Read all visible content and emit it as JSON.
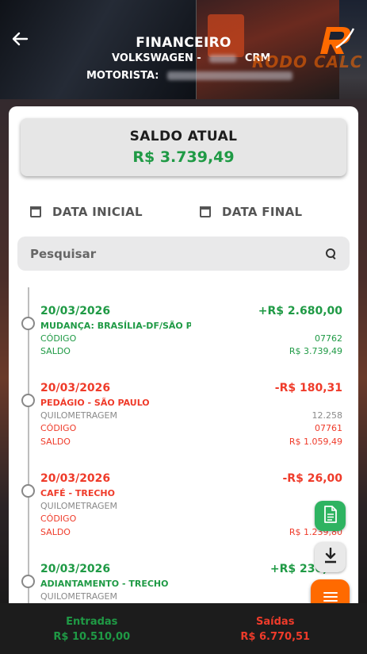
{
  "header": {
    "title": "FINANCEIRO",
    "vehicle_prefix": "VOLKSWAGEN -",
    "vehicle_suffix": "CRM",
    "driver_label": "MOTORISTA:",
    "logo_text": "RODO CALC"
  },
  "summary": {
    "label": "SALDO ATUAL",
    "value": "R$ 3.739,49"
  },
  "filters": {
    "start_date": "DATA INICIAL",
    "end_date": "DATA FINAL",
    "search_placeholder": "Pesquisar"
  },
  "labels": {
    "odometer": "QUILOMETRAGEM",
    "code": "CÓDIGO",
    "balance": "SALDO"
  },
  "entries": [
    {
      "date": "20/03/2026",
      "amount": "+R$  2.680,00",
      "description": "MUDANÇA: BRASÍLIA-DF/SÃO PAULO",
      "odometer": "",
      "code": "07762",
      "balance": "R$  3.739,49",
      "type": "income"
    },
    {
      "date": "20/03/2026",
      "amount": "-R$  180,31",
      "description": "PEDÁGIO - SÃO PAULO",
      "odometer": "12.258",
      "code": "07761",
      "balance": "R$  1.059,49",
      "type": "expense"
    },
    {
      "date": "20/03/2026",
      "amount": "-R$  26,00",
      "description": "CAFÉ - TRECHO",
      "odometer": "",
      "code": "",
      "balance": "R$  1.239,80",
      "type": "expense"
    },
    {
      "date": "20/03/2026",
      "amount": "+R$  230,00",
      "description": "ADIANTAMENTO - TRECHO",
      "odometer": "",
      "code": "",
      "balance": "",
      "type": "income"
    }
  ],
  "footer": {
    "income_label": "Entradas",
    "income_value": "R$ 10.510,00",
    "expense_label": "Saídas",
    "expense_value": "R$ 6.770,51"
  },
  "colors": {
    "accent": "#ff6a00",
    "income": "#1f9a45",
    "expense": "#ef3b2a"
  },
  "icons": [
    "back-arrow-icon",
    "calendar-icon",
    "search-icon",
    "document-icon",
    "download-icon",
    "menu-icon"
  ]
}
